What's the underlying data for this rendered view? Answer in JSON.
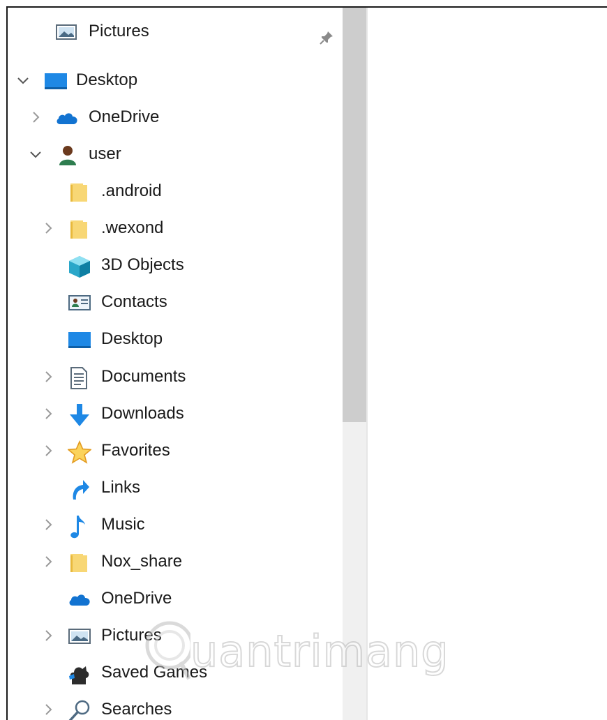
{
  "nav": {
    "quick_access": {
      "label": "Pictures",
      "icon": "pictures-icon",
      "pinned": true
    },
    "desktop": {
      "label": "Desktop",
      "expanded": true,
      "icon": "desktop-icon"
    },
    "onedrive": {
      "label": "OneDrive",
      "icon": "onedrive-icon"
    },
    "user": {
      "label": "user",
      "expanded": true,
      "icon": "user-icon"
    },
    "user_children": [
      {
        "label": ".android",
        "icon": "folder-icon",
        "expandable": false
      },
      {
        "label": ".wexond",
        "icon": "folder-icon",
        "expandable": true
      },
      {
        "label": "3D Objects",
        "icon": "3d-objects-icon",
        "expandable": false
      },
      {
        "label": "Contacts",
        "icon": "contacts-icon",
        "expandable": false
      },
      {
        "label": "Desktop",
        "icon": "desktop-icon",
        "expandable": false
      },
      {
        "label": "Documents",
        "icon": "documents-icon",
        "expandable": true
      },
      {
        "label": "Downloads",
        "icon": "downloads-icon",
        "expandable": true
      },
      {
        "label": "Favorites",
        "icon": "favorites-icon",
        "expandable": true
      },
      {
        "label": "Links",
        "icon": "links-icon",
        "expandable": false
      },
      {
        "label": "Music",
        "icon": "music-icon",
        "expandable": true
      },
      {
        "label": "Nox_share",
        "icon": "folder-icon",
        "expandable": true
      },
      {
        "label": "OneDrive",
        "icon": "onedrive-icon",
        "expandable": false
      },
      {
        "label": "Pictures",
        "icon": "pictures-icon",
        "expandable": true
      },
      {
        "label": "Saved Games",
        "icon": "saved-games-icon",
        "expandable": false
      },
      {
        "label": "Searches",
        "icon": "searches-icon",
        "expandable": true
      }
    ]
  },
  "watermark": {
    "text": "uantrimang",
    "logo": "quantrimang-logo"
  },
  "colors": {
    "folder": "#f8d775",
    "desktop_blue": "#1e88e5",
    "onedrive_blue": "#0364b8",
    "scroll_thumb": "#cdcdcd",
    "scroll_track": "#f0f0f0"
  }
}
